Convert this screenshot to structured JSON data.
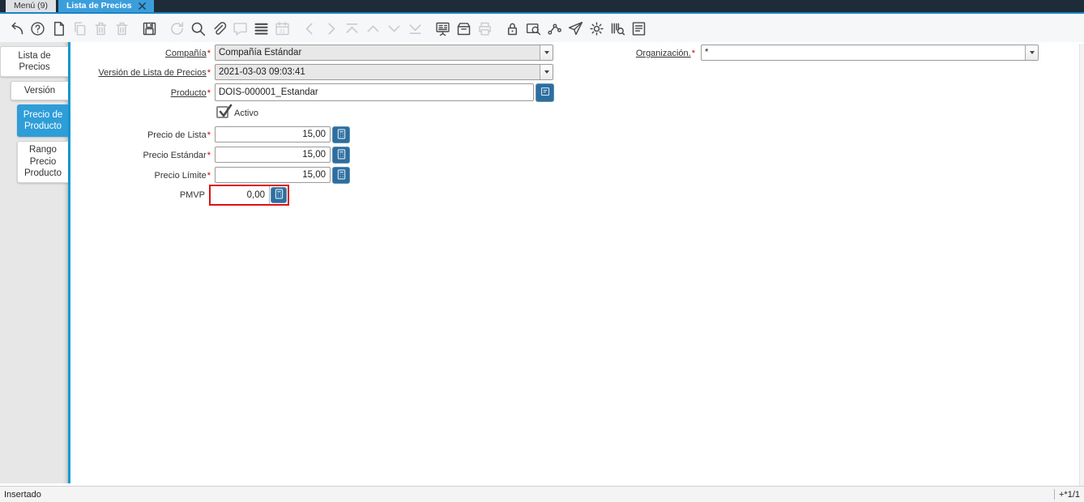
{
  "window": {
    "tabs": [
      {
        "label": "Menú (9)",
        "active": false
      },
      {
        "label": "Lista de Precios",
        "active": true,
        "closable": true
      }
    ]
  },
  "toolbar": {
    "buttons": [
      {
        "name": "undo",
        "enabled": true
      },
      {
        "name": "help",
        "enabled": true
      },
      {
        "name": "new-record",
        "enabled": true
      },
      {
        "name": "copy-record",
        "enabled": false
      },
      {
        "name": "delete-record",
        "enabled": false
      },
      {
        "name": "delete-selection",
        "enabled": false
      },
      {
        "name": "save",
        "enabled": true
      },
      {
        "name": "refresh",
        "enabled": false
      },
      {
        "name": "find",
        "enabled": true
      },
      {
        "name": "attachment",
        "enabled": true
      },
      {
        "name": "chat",
        "enabled": false
      },
      {
        "name": "grid-toggle",
        "enabled": true
      },
      {
        "name": "calendar",
        "enabled": false
      },
      {
        "name": "previous",
        "enabled": false
      },
      {
        "name": "next",
        "enabled": false
      },
      {
        "name": "first-record",
        "enabled": false
      },
      {
        "name": "up",
        "enabled": false
      },
      {
        "name": "down",
        "enabled": false
      },
      {
        "name": "last-record",
        "enabled": false
      },
      {
        "name": "detail",
        "enabled": true
      },
      {
        "name": "archive",
        "enabled": true
      },
      {
        "name": "print",
        "enabled": false
      },
      {
        "name": "lock",
        "enabled": true
      },
      {
        "name": "zoom-across",
        "enabled": true
      },
      {
        "name": "workflow",
        "enabled": true
      },
      {
        "name": "send",
        "enabled": true
      },
      {
        "name": "preferences",
        "enabled": true
      },
      {
        "name": "barcode-scan",
        "enabled": true
      },
      {
        "name": "report",
        "enabled": true
      }
    ]
  },
  "sidebar": {
    "active_tab": "Precio de Producto",
    "tabs": [
      {
        "label": "Lista de Precios",
        "active": false
      },
      {
        "label": "Versión",
        "active": false
      },
      {
        "label": "Precio de Producto",
        "active": true
      },
      {
        "label": "Rango Precio Producto",
        "active": false
      }
    ]
  },
  "form": {
    "required_mark": "*",
    "fields": {
      "compania": {
        "label": "Compañía",
        "required": true,
        "value": "Compañía Estándar",
        "type": "combobox",
        "readonly": true
      },
      "organizacion": {
        "label": "Organización.",
        "required": true,
        "value": "*",
        "type": "combobox",
        "readonly": false
      },
      "version": {
        "label": "Versión de Lista de Precios",
        "required": true,
        "value": "2021-03-03 09:03:41",
        "type": "combobox",
        "readonly": true
      },
      "producto": {
        "label": "Producto",
        "required": true,
        "value": "DOIS-000001_Estandar",
        "type": "search"
      },
      "activo": {
        "label": "Activo",
        "checked": true,
        "type": "checkbox"
      },
      "precio_lista": {
        "label": "Precio de Lista",
        "required": true,
        "value": "15,00",
        "type": "amount"
      },
      "precio_estandar": {
        "label": "Precio Estándar",
        "required": true,
        "value": "15,00",
        "type": "amount"
      },
      "precio_limite": {
        "label": "Precio Límite",
        "required": true,
        "value": "15,00",
        "type": "amount"
      },
      "pmvp": {
        "label": "PMVP",
        "required": false,
        "value": "0,00",
        "type": "amount",
        "highlighted": true
      }
    }
  },
  "statusbar": {
    "status": "Insertado",
    "record_indicator": "+*1/1"
  },
  "colors": {
    "tabbar_bg": "#1e2c39",
    "active_tab_blue": "#3b9edb",
    "sidebar_active_blue": "#2e9dd8",
    "sidebar_accent_line": "#0f9ad6",
    "field_button_blue": "#2e6e9e",
    "highlight_red": "#dd1111",
    "required_red": "#cc0000"
  }
}
